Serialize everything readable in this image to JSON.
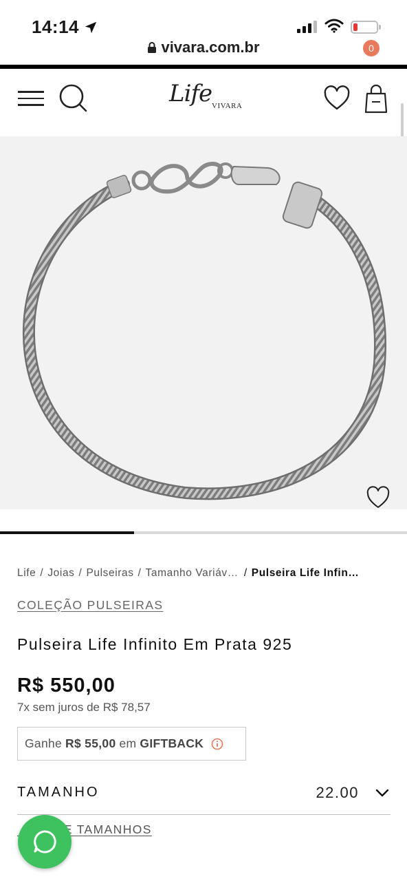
{
  "status_bar": {
    "time": "14:14",
    "url": "vivara.com.br",
    "battery_color": "#e53935"
  },
  "header": {
    "logo_script": "Life",
    "logo_sub": "VIVARA",
    "cart_count": "0",
    "badge_color": "#e8795a"
  },
  "gallery": {
    "progress": 0.33
  },
  "breadcrumb": {
    "items": [
      "Life",
      "Joias",
      "Pulseiras",
      "Tamanho Variáv…"
    ],
    "current": "Pulseira Life Infin…",
    "separator": "/"
  },
  "product": {
    "collection_link": "COLEÇÃO PULSEIRAS",
    "title": "Pulseira Life Infinito Em Prata 925",
    "price": "R$ 550,00",
    "installments": "7x sem juros de R$ 78,57",
    "giftback": {
      "prefix": "Ganhe",
      "amount": "R$ 55,00",
      "middle": "em",
      "label": "GIFTBACK"
    }
  },
  "size_selector": {
    "label": "TAMANHO",
    "value": "22.00"
  },
  "size_guide": {
    "visible_text": "E TAMANHOS"
  },
  "colors": {
    "whatsapp": "#3ec25f",
    "accent": "#e8795a"
  }
}
